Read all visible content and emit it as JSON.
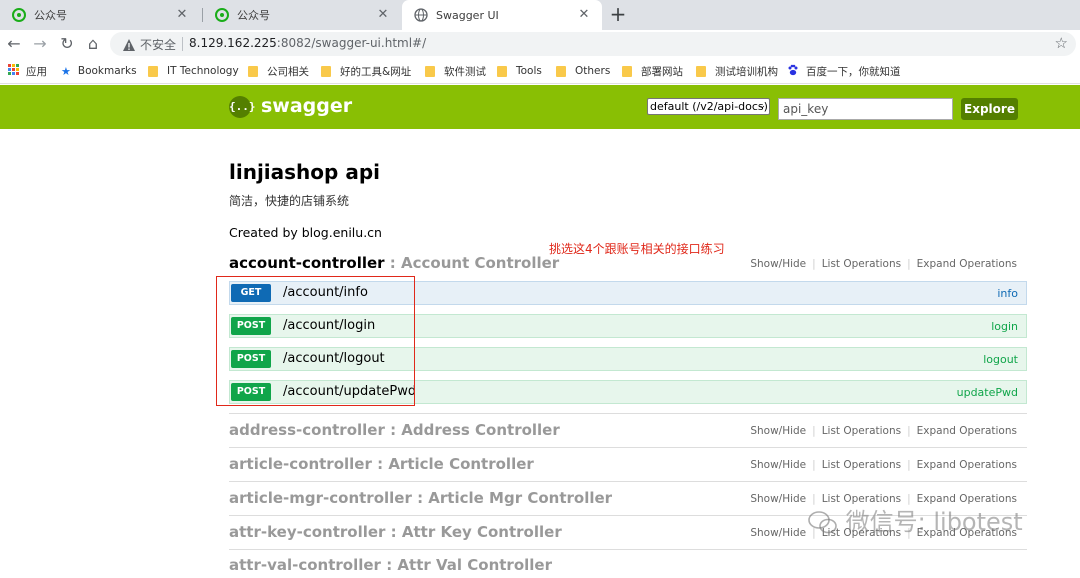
{
  "browser": {
    "tabs": [
      {
        "title": "公众号",
        "icon": "wechat-icon",
        "active": false
      },
      {
        "title": "公众号",
        "icon": "wechat-icon",
        "active": false
      },
      {
        "title": "Swagger UI",
        "icon": "globe-icon",
        "active": true
      }
    ],
    "insecure_label": "不安全",
    "url_host": "8.129.162.225",
    "url_rest": ":8082/swagger-ui.html#/"
  },
  "bookmarks": [
    {
      "label": "应用",
      "icon": "apps-grid-icon"
    },
    {
      "label": "Bookmarks",
      "icon": "star-icon"
    },
    {
      "label": "IT Technology",
      "icon": "folder-icon"
    },
    {
      "label": "公司相关",
      "icon": "folder-icon"
    },
    {
      "label": "好的工具&网址",
      "icon": "folder-icon"
    },
    {
      "label": "软件测试",
      "icon": "folder-icon"
    },
    {
      "label": "Tools",
      "icon": "folder-icon"
    },
    {
      "label": "Others",
      "icon": "folder-icon"
    },
    {
      "label": "部署网站",
      "icon": "folder-icon"
    },
    {
      "label": "测试培训机构",
      "icon": "folder-icon"
    },
    {
      "label": "百度一下，你就知道",
      "icon": "baidu-paw-icon"
    }
  ],
  "swagger": {
    "logo_glyph": "{..}",
    "brand": "swagger",
    "spec_select": "default (/v2/api-docs)",
    "api_key_placeholder": "api_key",
    "explore_label": "Explore",
    "header_color": "#89bf04"
  },
  "api": {
    "title": "linjiashop api",
    "description": "简洁，快捷的店铺系统",
    "created": "Created by blog.enilu.cn"
  },
  "annotation": "挑选这4个跟账号相关的接口练习",
  "actions": {
    "show_hide": "Show/Hide",
    "list_ops": "List Operations",
    "expand_ops": "Expand Operations"
  },
  "controllers": [
    {
      "path": "account-controller",
      "desc": " : Account Controller"
    },
    {
      "path": "address-controller",
      "desc": " : Address Controller"
    },
    {
      "path": "article-controller",
      "desc": " : Article Controller"
    },
    {
      "path": "article-mgr-controller",
      "desc": " : Article Mgr Controller"
    },
    {
      "path": "attr-key-controller",
      "desc": " : Attr Key Controller"
    },
    {
      "path": "attr-val-controller",
      "desc": " : Attr Val Controller"
    }
  ],
  "operations": [
    {
      "method": "GET",
      "path": "/account/info",
      "summary": "info"
    },
    {
      "method": "POST",
      "path": "/account/login",
      "summary": "login"
    },
    {
      "method": "POST",
      "path": "/account/logout",
      "summary": "logout"
    },
    {
      "method": "POST",
      "path": "/account/updatePwd",
      "summary": "updatePwd"
    }
  ],
  "watermark": "微信号: libotest"
}
